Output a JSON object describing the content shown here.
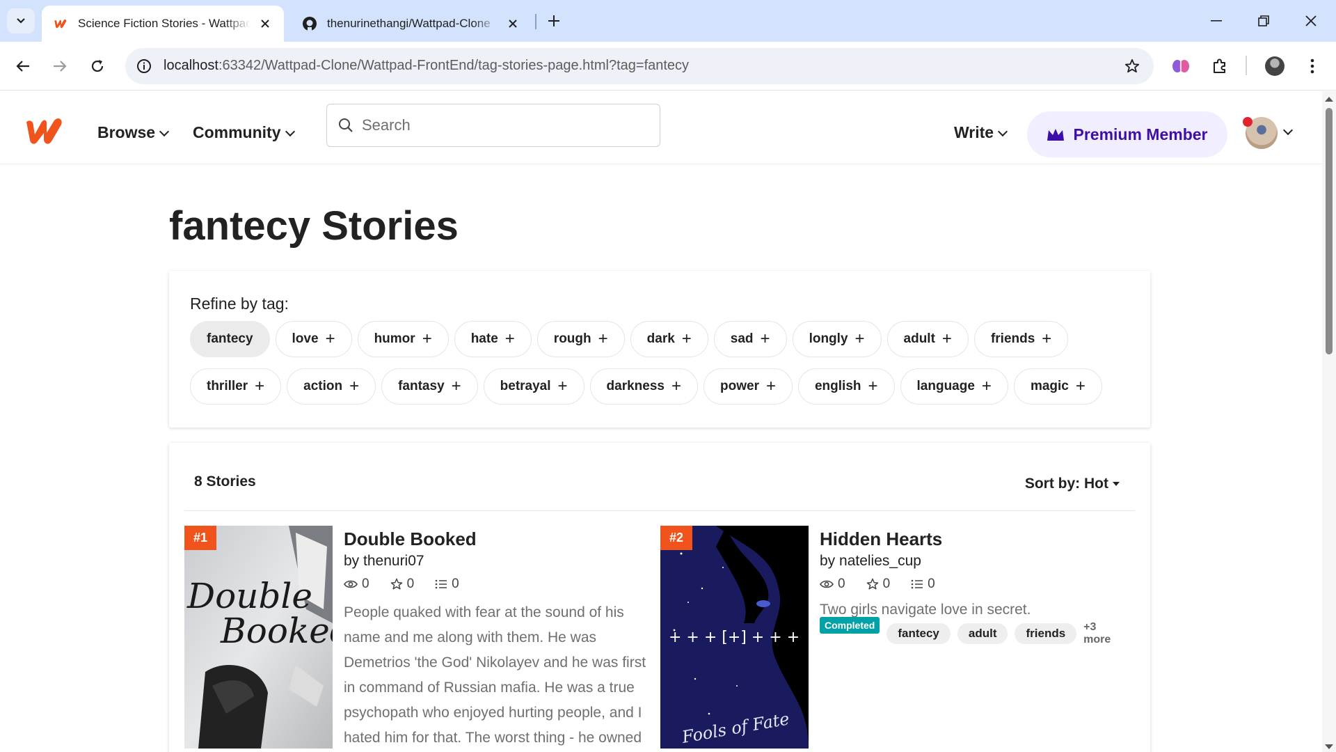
{
  "browser": {
    "tabs": [
      {
        "title": "Science Fiction Stories - Wattpad",
        "active": true
      },
      {
        "title": "thenurinethangi/Wattpad-Clone",
        "active": false
      }
    ],
    "url_host": "localhost",
    "url_rest": ":63342/Wattpad-Clone/Wattpad-FrontEnd/tag-stories-page.html?tag=fantecy"
  },
  "header": {
    "nav": [
      "Browse",
      "Community"
    ],
    "search_placeholder": "Search",
    "write_label": "Write",
    "premium_label": "Premium Member",
    "brand_color": "#f0531c",
    "premium_color": "#3d0fa8"
  },
  "page": {
    "title": "fantecy Stories",
    "refine_label": "Refine by tag:",
    "selected_tag": "fantecy",
    "tags_row1": [
      "love",
      "humor",
      "hate",
      "rough",
      "dark",
      "sad",
      "longly",
      "adult",
      "friends"
    ],
    "tags_row2": [
      "thriller",
      "action",
      "fantasy",
      "betrayal",
      "darkness",
      "power",
      "english",
      "language",
      "magic"
    ],
    "stories_count": "8 Stories",
    "sort_label": "Sort by: Hot"
  },
  "stories": [
    {
      "rank": "#1",
      "title": "Double Booked",
      "author": "by thenuri07",
      "reads": "0",
      "votes": "0",
      "parts": "0",
      "cover_text_1": "Double",
      "cover_text_2": "Booked",
      "description": "People quaked with fear at the sound of his name and me along with them. He was Demetrios 'the God' Nikolayev and he was first in command of Russian mafia. He was a true psychopath who enjoyed hurting people, and I hated him for that. The worst thing - he owned"
    },
    {
      "rank": "#2",
      "title": "Hidden Hearts",
      "author": "by natelies_cup",
      "reads": "0",
      "votes": "0",
      "parts": "0",
      "cover_title": "Fools of Fate",
      "description": "Two girls navigate love in secret.",
      "status": "Completed",
      "tags": [
        "fantecy",
        "adult",
        "friends"
      ],
      "more": "+3 more"
    }
  ]
}
